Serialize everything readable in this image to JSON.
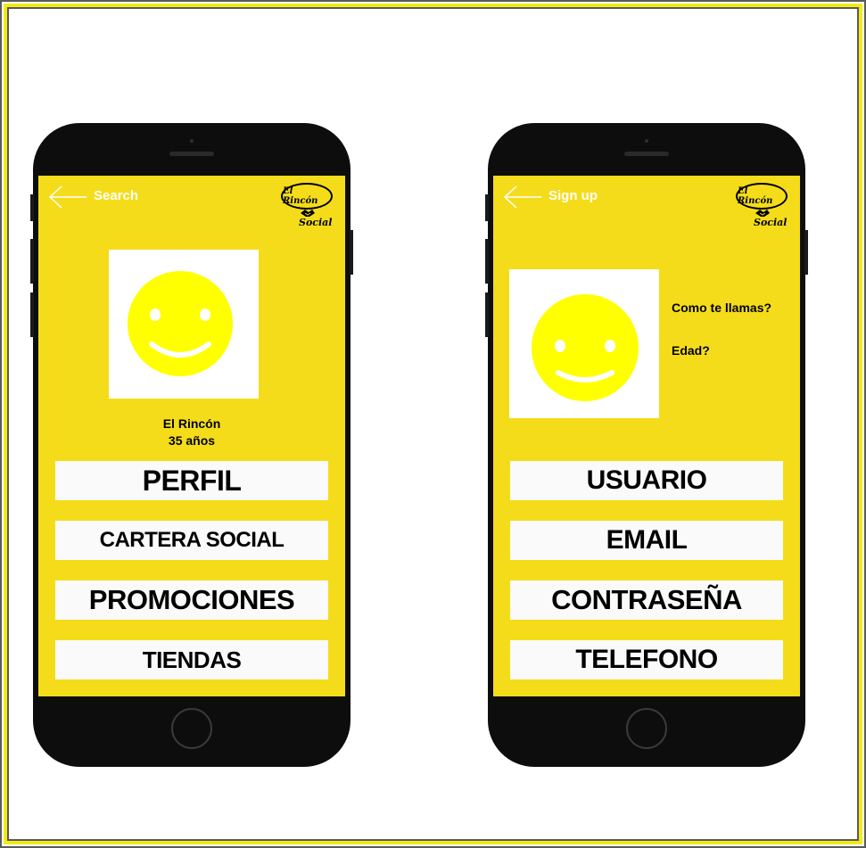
{
  "colors": {
    "screen_bg": "#f5dc1a",
    "frame_accent": "#f2ea1a",
    "phone_body": "#0d0d0d",
    "smiley": "#ffff00"
  },
  "left_phone": {
    "nav_title": "Search",
    "logo": {
      "line1": "El Rincón",
      "line2": "Social",
      "icon": "handshake-icon"
    },
    "profile": {
      "name": "El Rincón",
      "age": "35 años"
    },
    "menu": [
      {
        "label": "PERFIL"
      },
      {
        "label": "CARTERA SOCIAL"
      },
      {
        "label": "PROMOCIONES"
      },
      {
        "label": "TIENDAS"
      }
    ]
  },
  "right_phone": {
    "nav_title": "Sign up",
    "logo": {
      "line1": "El Rincón",
      "line2": "Social",
      "icon": "handshake-icon"
    },
    "questions": {
      "name_prompt": "Como te llamas?",
      "age_prompt": "Edad?"
    },
    "fields": [
      {
        "label": "USUARIO"
      },
      {
        "label": "EMAIL"
      },
      {
        "label": "CONTRASEÑA"
      },
      {
        "label": "TELEFONO"
      }
    ]
  }
}
